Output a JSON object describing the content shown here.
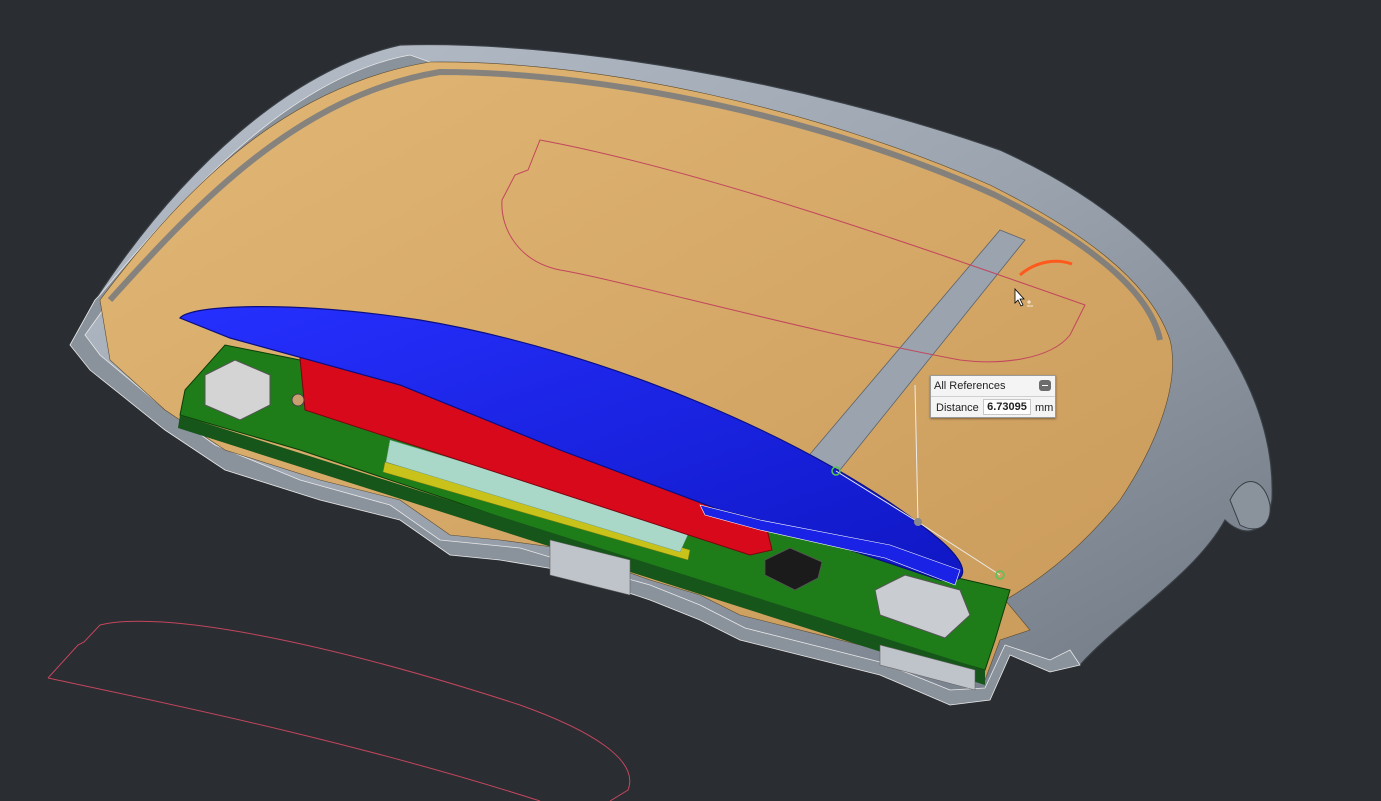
{
  "viewport": {
    "background": "#2a2d31"
  },
  "colors": {
    "shell_exterior": "#9aa3ae",
    "shell_interior": "#d9ac6c",
    "battery": "#1a22e6",
    "pcb_red": "#d8091b",
    "pcb_green": "#1f7d19",
    "sketch_curve": "#c2465e",
    "highlight_edge": "#ff5a1e",
    "measure_point": "#56c456"
  },
  "measure_popup": {
    "title": "All References",
    "rows": [
      {
        "label": "Distance",
        "value": "6.73095",
        "unit": "mm"
      }
    ]
  },
  "icons": {
    "collapse": "minus-collapse-icon",
    "cursor": "arrow-cursor-icon"
  }
}
